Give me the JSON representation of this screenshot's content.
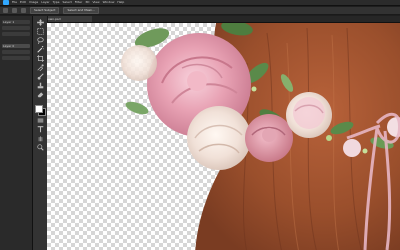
{
  "app": {
    "menu_items": [
      "File",
      "Edit",
      "Image",
      "Layer",
      "Type",
      "Select",
      "Filter",
      "3D",
      "View",
      "Window",
      "Help"
    ]
  },
  "options_bar": {
    "tool_icon": "magic-wand-icon",
    "buttons": [
      "Select Subject",
      "Select and Mask..."
    ]
  },
  "document_tab": {
    "label": "flower-crown.psd"
  },
  "left_panel": {
    "rows": [
      "Layer 1",
      "",
      "",
      "Layer 0",
      "",
      ""
    ]
  },
  "tools": [
    "move-icon",
    "marquee-icon",
    "lasso-icon",
    "magic-wand-icon",
    "crop-icon",
    "eyedropper-icon",
    "healing-brush-icon",
    "brush-icon",
    "clone-stamp-icon",
    "history-brush-icon",
    "eraser-icon",
    "gradient-icon",
    "blur-icon",
    "dodge-icon",
    "pen-icon",
    "type-icon",
    "path-selection-icon",
    "rectangle-icon",
    "hand-icon",
    "zoom-icon"
  ],
  "colors": {
    "foreground": "#ffffff",
    "background": "#000000",
    "accent": "#31a8ff",
    "hair": "#a0522d",
    "rose_pink": "#e8a2b4",
    "rose_white": "#f3e4dc",
    "leaf": "#5a8a4a",
    "ribbon": "#e7b6c4"
  }
}
